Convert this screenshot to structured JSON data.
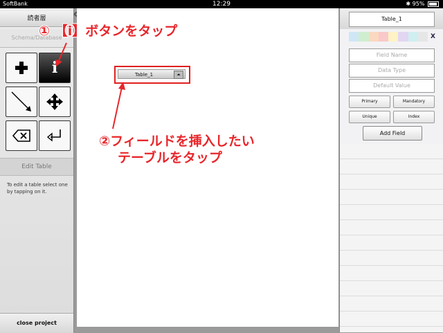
{
  "status_bar": {
    "carrier": "SoftBank",
    "time": "12:29",
    "battery": "95%"
  },
  "left_panel": {
    "title": "読者層",
    "schema_label": "Schema/Database",
    "tools": [
      {
        "icon": "plus-icon"
      },
      {
        "icon": "info-icon",
        "label": "i"
      },
      {
        "icon": "arrow-line-icon"
      },
      {
        "icon": "move-icon"
      },
      {
        "icon": "delete-icon"
      },
      {
        "icon": "return-icon"
      }
    ],
    "edit_table_label": "Edit Table",
    "help_text": "To edit a table select one by tapping on it.",
    "close_label": "close project"
  },
  "canvas": {
    "table_name": "Table_1"
  },
  "annotations": {
    "step1": "① 【i】ボタンをタップ",
    "step2_line1": "②フィールドを挿入したい",
    "step2_line2": "テーブルをタップ"
  },
  "right_panel": {
    "table_name": "Table_1",
    "close_x": "X",
    "colors": [
      "#cfe6f7",
      "#cfeecf",
      "#fbd8c0",
      "#f9c9c9",
      "#fef3c4",
      "#e2d6f2",
      "#cfeef0",
      "#e6e6e6"
    ],
    "field_name_placeholder": "Field Name",
    "data_type_placeholder": "Data Type",
    "default_value_placeholder": "Default Value",
    "primary_label": "Primary",
    "mandatory_label": "Mandatory",
    "unique_label": "Unique",
    "index_label": "Index",
    "add_field_label": "Add Field"
  },
  "colors": {
    "accent_red": "#e8262b"
  }
}
